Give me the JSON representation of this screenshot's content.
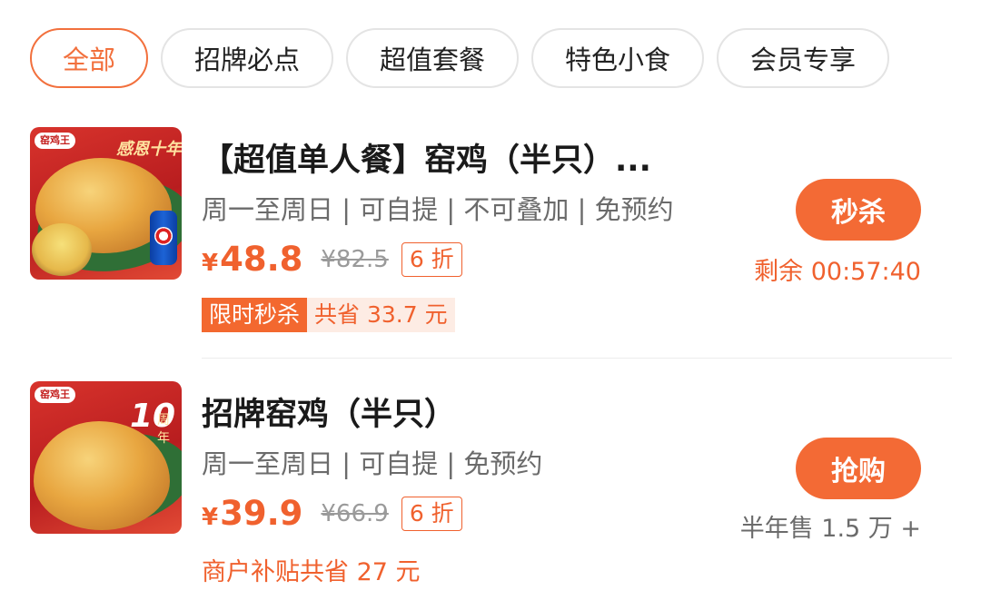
{
  "tabs": [
    {
      "label": "全部",
      "active": true
    },
    {
      "label": "招牌必点",
      "active": false
    },
    {
      "label": "超值套餐",
      "active": false
    },
    {
      "label": "特色小食",
      "active": false
    },
    {
      "label": "会员专享",
      "active": false
    }
  ],
  "items": [
    {
      "thumb_brand": "窑鸡王",
      "thumb_banner": "感恩十年",
      "title": "【超值单人餐】窑鸡（半只）...",
      "meta": "周一至周日 | 可自提 | 不可叠加 | 免预约",
      "currency": "¥",
      "price": "48.8",
      "original_price": "¥82.5",
      "discount": "6 折",
      "flash_tag": "限时秒杀",
      "flash_save": "共省 33.7 元",
      "button": "秒杀",
      "side_text": "剩余 00:57:40"
    },
    {
      "thumb_brand": "窑鸡王",
      "thumb_ten": "10",
      "thumb_ten_sub": "周年",
      "title": "招牌窑鸡（半只）",
      "meta": "周一至周日 | 可自提 | 免预约",
      "currency": "¥",
      "price": "39.9",
      "original_price": "¥66.9",
      "discount": "6 折",
      "subsidy": "商户补贴共省 27 元",
      "button": "抢购",
      "side_text": "半年售 1.5 万 +"
    }
  ],
  "colors": {
    "accent": "#f36a35",
    "text_muted": "#6b6b6b"
  }
}
